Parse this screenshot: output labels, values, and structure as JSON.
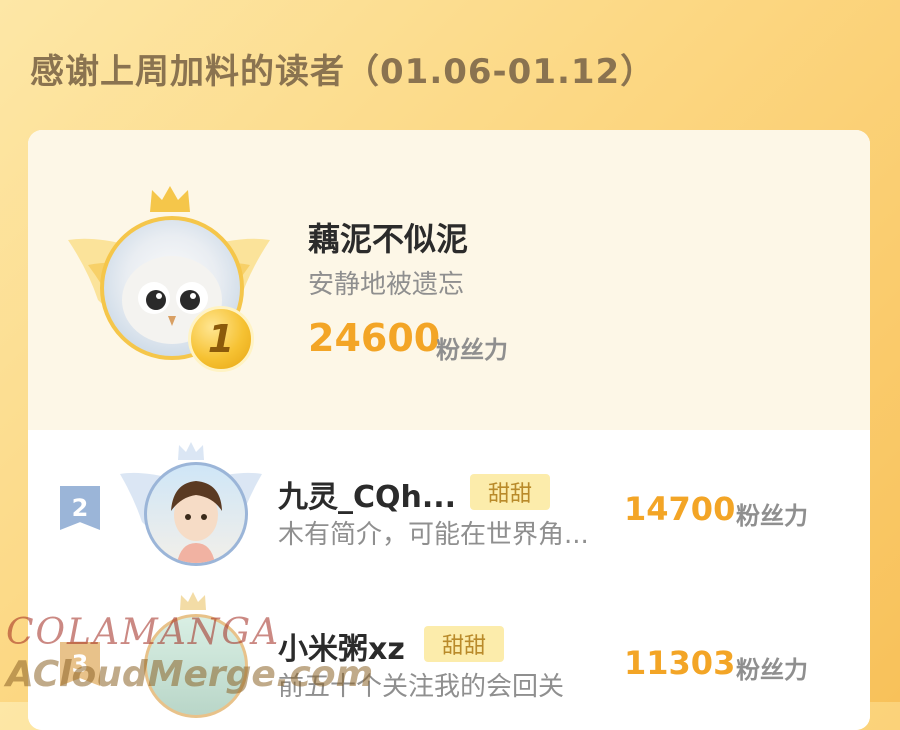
{
  "page": {
    "title": "感谢上周加料的读者（01.06-01.12）"
  },
  "top_reader": {
    "rank": "1",
    "name": "藕泥不似泥",
    "bio": "安静地被遗忘",
    "score": "24600",
    "unit": "粉丝力"
  },
  "readers": [
    {
      "rank": "2",
      "name": "九灵_CQh...",
      "badge": "甜甜",
      "bio": "木有简介，可能在世界角...",
      "score": "14700",
      "unit": "粉丝力"
    },
    {
      "rank": "3",
      "name": "小米粥xz",
      "badge": "甜甜",
      "bio": "前五十个关注我的会回关",
      "score": "11303",
      "unit": "粉丝力"
    }
  ],
  "watermarks": {
    "line1": "COLAMANGA",
    "line2": "ACloudMerge.com"
  },
  "colors": {
    "accent": "#f3a526",
    "badge_bg": "#fcecab",
    "rank2_tag": "#9bb5d8"
  }
}
